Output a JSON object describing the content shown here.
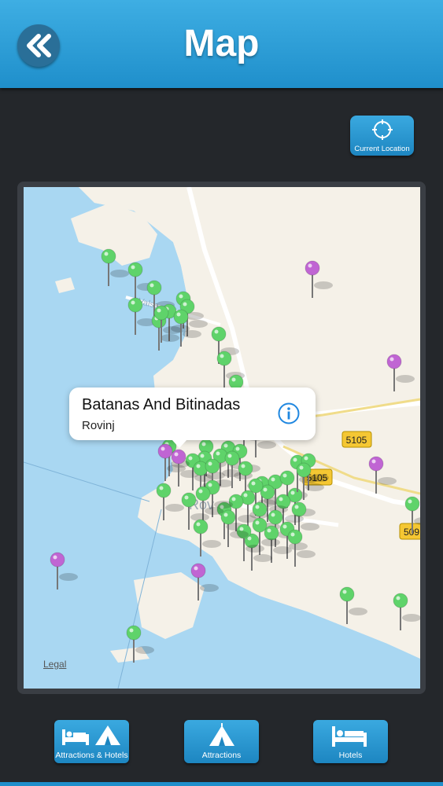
{
  "header": {
    "title": "Map",
    "back_icon": "double-chevron-left-icon"
  },
  "current_location": {
    "label": "Current Location",
    "icon": "crosshair-icon"
  },
  "callout": {
    "title": "Batanas And Bitinadas",
    "subtitle": "Rovinj",
    "icon": "info-icon"
  },
  "map": {
    "legal_label": "Legal",
    "town_label": "Rov",
    "place_label_top": "Valsa",
    "road_badges": [
      "5105",
      "5105",
      "509"
    ],
    "colors": {
      "water": "#a9d7f2",
      "land": "#f5f1e8",
      "road": "#ffffff",
      "pin_green": "#5fd36a",
      "pin_purple": "#c065d3",
      "badge": "#f5c733"
    }
  },
  "bottom_tabs": [
    {
      "label": "Attractions & Hotels",
      "icon": "bed-and-tent-icon"
    },
    {
      "label": "Attractions",
      "icon": "tent-icon"
    },
    {
      "label": "Hotels",
      "icon": "bed-icon"
    }
  ],
  "colors": {
    "header": "#2b9fd8",
    "background": "#24272b"
  }
}
